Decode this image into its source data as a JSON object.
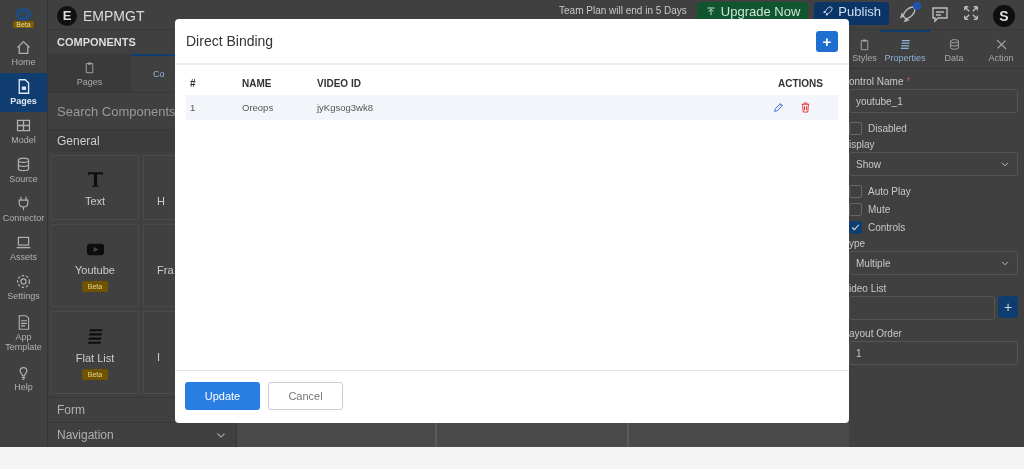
{
  "header": {
    "logo_badge": "Beta",
    "project_initial": "E",
    "project_name": "EMPMGT",
    "plan_notice": "Team Plan will end in 5 Days",
    "upgrade_label": "Upgrade Now",
    "publish_label": "Publish",
    "has_notification": true,
    "avatar_initial": "S"
  },
  "nav": [
    {
      "label": "Home",
      "selected": false
    },
    {
      "label": "Pages",
      "selected": true
    },
    {
      "label": "Model",
      "selected": false
    },
    {
      "label": "Source",
      "selected": false
    },
    {
      "label": "Connector",
      "selected": false
    },
    {
      "label": "Assets",
      "selected": false
    },
    {
      "label": "Settings",
      "selected": false
    },
    {
      "label": "App Template",
      "selected": false
    },
    {
      "label": "Help",
      "selected": false
    }
  ],
  "components_panel": {
    "title": "COMPONENTS",
    "tabs": [
      {
        "label": "Pages",
        "selected": false
      },
      {
        "label": "Co",
        "selected": true
      }
    ],
    "search": {
      "placeholder": "Search Components"
    },
    "group": "General",
    "items": [
      {
        "label": "Text"
      },
      {
        "label": "H"
      },
      {
        "label": "Youtube",
        "badge": "Beta"
      },
      {
        "label": "Fra"
      },
      {
        "label": "Flat List",
        "badge": "Beta"
      },
      {
        "label": "I"
      }
    ],
    "sections": [
      {
        "label": "Form"
      },
      {
        "label": "Navigation"
      }
    ]
  },
  "properties_panel": {
    "tabs": [
      {
        "label": "Styles",
        "selected": false
      },
      {
        "label": "Properties",
        "selected": true
      },
      {
        "label": "Data",
        "selected": false
      },
      {
        "label": "Action",
        "selected": false
      }
    ],
    "fields": [
      {
        "kind": "input",
        "label": "ontrol Name",
        "required_mark": "*",
        "value": "youtube_1"
      },
      {
        "kind": "checkbox",
        "label": "Disabled",
        "checked": false
      },
      {
        "kind": "select",
        "label": "isplay",
        "value": "Show"
      },
      {
        "kind": "checkbox",
        "label": "Auto Play",
        "checked": false
      },
      {
        "kind": "checkbox",
        "label": "Mute",
        "checked": false
      },
      {
        "kind": "checkbox",
        "label": "Controls",
        "checked": true
      },
      {
        "kind": "select",
        "label": "ype",
        "value": "Multiple"
      },
      {
        "kind": "list",
        "label": "ideo List",
        "button": "+"
      },
      {
        "kind": "input",
        "label": "ayout Order",
        "value": "1"
      }
    ]
  },
  "dialog": {
    "title": "Direct Binding",
    "add_label": "+",
    "columns": [
      "#",
      "NAME",
      "VIDEO ID",
      "ACTIONS"
    ],
    "rows": [
      {
        "cells": [
          "1",
          "Oreops",
          "jyKgsog3wk8"
        ]
      }
    ],
    "buttons": [
      {
        "label": "Update",
        "kind": "primary"
      },
      {
        "label": "Cancel",
        "kind": "secondary"
      }
    ]
  }
}
